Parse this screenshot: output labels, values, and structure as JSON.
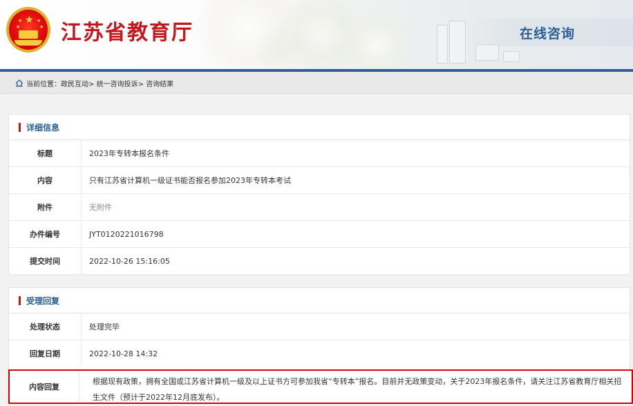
{
  "header": {
    "site_title": "江苏省教育厅",
    "section_title": "在线咨询",
    "emblem": "national-emblem"
  },
  "breadcrumb": {
    "prefix": "当前位置：",
    "items": [
      "政民互动",
      "统一咨询投诉",
      "咨询结果"
    ],
    "separator": "> ",
    "icon": "home-icon"
  },
  "detail": {
    "heading": "详细信息",
    "rows": [
      {
        "label": "标题",
        "value": "2023年专转本报名条件"
      },
      {
        "label": "内容",
        "value": "只有江苏省计算机一级证书能否报名参加2023年专转本考试"
      },
      {
        "label": "附件",
        "value": "无附件"
      },
      {
        "label": "办件编号",
        "value": "JYT0120221016798"
      },
      {
        "label": "提交时间",
        "value": "2022-10-26 15:16:05"
      }
    ]
  },
  "reply": {
    "heading": "受理回复",
    "rows": [
      {
        "label": "处理状态",
        "value": "处理完毕"
      },
      {
        "label": "回复日期",
        "value": "2022-10-28 14:32"
      }
    ],
    "content_label": "内容回复",
    "content": "根据现有政策，拥有全国或江苏省计算机一级及以上证书方可参加我省“专转本”报名。目前并无政策变动，关于2023年报名条件，请关注江苏省教育厅相关招生文件（预计于2022年12月底发布）。"
  },
  "colors": {
    "brand_red": "#c4161c",
    "header_blue": "#2d5f96",
    "heading_blue": "#2a5f92",
    "highlight_border": "#d40000"
  }
}
